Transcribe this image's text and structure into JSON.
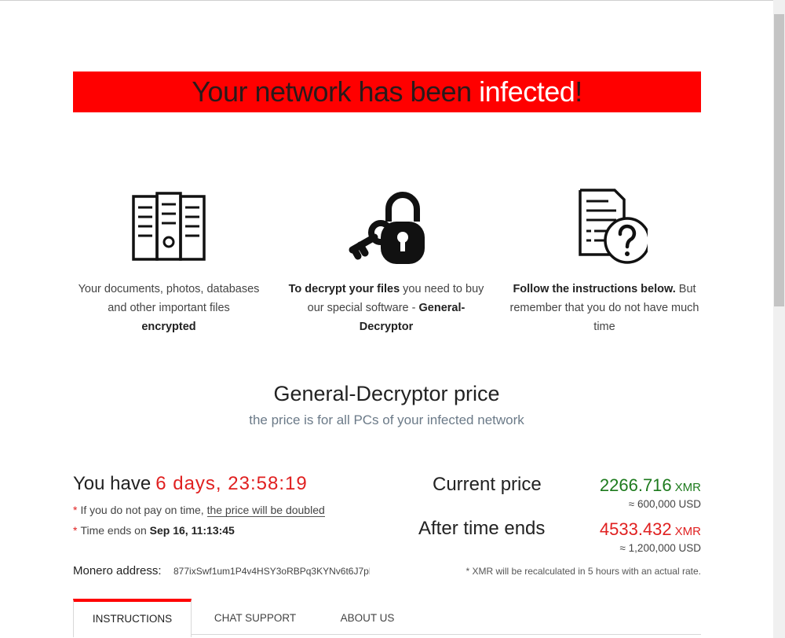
{
  "banner": {
    "part1": "Your network has been ",
    "highlight": "infected",
    "end": "!"
  },
  "features": [
    {
      "icon": "file-cabinet-icon",
      "text_before": "Your documents, photos, databases and other important files",
      "bold": "encrypted",
      "text_after": ""
    },
    {
      "icon": "key-lock-icon",
      "bold1": "To decrypt your files",
      "text_mid": " you need to buy our special software - ",
      "bold2": "General-Decryptor"
    },
    {
      "icon": "document-question-icon",
      "bold": "Follow the instructions below.",
      "text_after": " But remember that you do not have much time"
    }
  ],
  "price_section": {
    "title": "General-Decryptor price",
    "subtitle": "the price is for all PCs of your infected network"
  },
  "countdown": {
    "label": "You have",
    "timer": "6 days, 23:58:19",
    "note1_prefix": "If you do not pay on time, ",
    "note1_link": "the price will be doubled",
    "note2_prefix": "Time ends on ",
    "note2_date": "Sep 16, 11:13:45"
  },
  "prices": {
    "current_label": "Current price",
    "current_xmr": "2266.716",
    "current_unit": "XMR",
    "current_usd": "≈ 600,000 USD",
    "after_label": "After time ends",
    "after_xmr": "4533.432",
    "after_unit": "XMR",
    "after_usd": "≈ 1,200,000 USD"
  },
  "monero": {
    "label": "Monero address:",
    "address": "877ixSwf1um1P4v4HSY3oRBPq3KYNv6t6J7pE",
    "recalc_note": "* XMR will be recalculated in 5 hours with an actual rate."
  },
  "tabs": [
    {
      "label": "INSTRUCTIONS",
      "active": true
    },
    {
      "label": "CHAT SUPPORT",
      "active": false
    },
    {
      "label": "ABOUT US",
      "active": false
    }
  ],
  "colors": {
    "banner_bg": "#ff0000",
    "accent_red": "#e02020",
    "price_green": "#1d7a1d",
    "subtitle_gray": "#6b7a88"
  }
}
